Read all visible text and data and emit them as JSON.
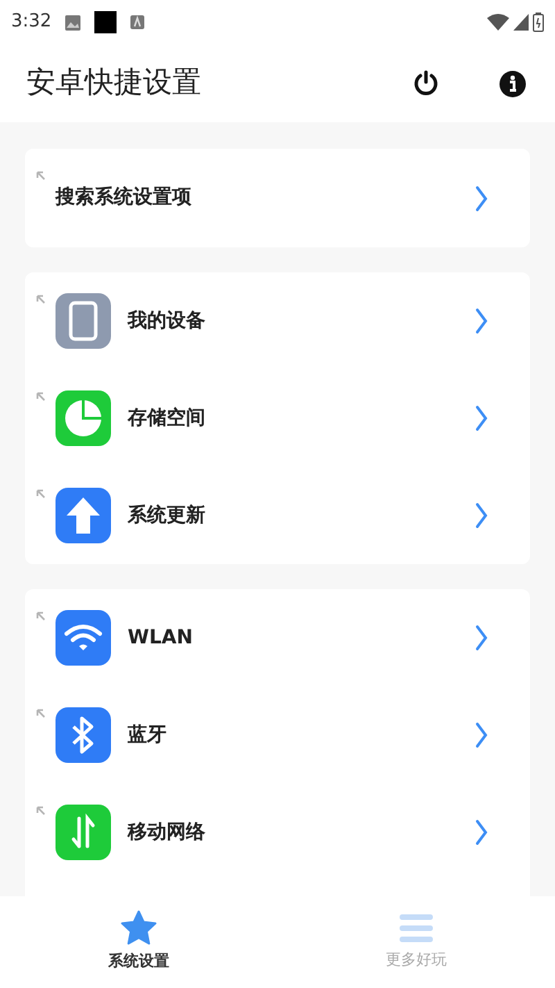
{
  "status_bar": {
    "time": "3:32"
  },
  "header": {
    "title": "安卓快捷设置"
  },
  "groups": [
    {
      "items": [
        {
          "label": "搜索系统设置项",
          "kind": "plain"
        }
      ]
    },
    {
      "items": [
        {
          "label": "我的设备",
          "kind": "device"
        },
        {
          "label": "存储空间",
          "kind": "storage"
        },
        {
          "label": "系统更新",
          "kind": "update"
        }
      ]
    },
    {
      "items": [
        {
          "label": "WLAN",
          "kind": "wifi"
        },
        {
          "label": "蓝牙",
          "kind": "bluetooth"
        },
        {
          "label": "移动网络",
          "kind": "mobile-data"
        }
      ]
    }
  ],
  "bottom_nav": [
    {
      "label": "系统设置",
      "kind": "star",
      "selected": true
    },
    {
      "label": "更多好玩",
      "kind": "list",
      "selected": false
    }
  ]
}
